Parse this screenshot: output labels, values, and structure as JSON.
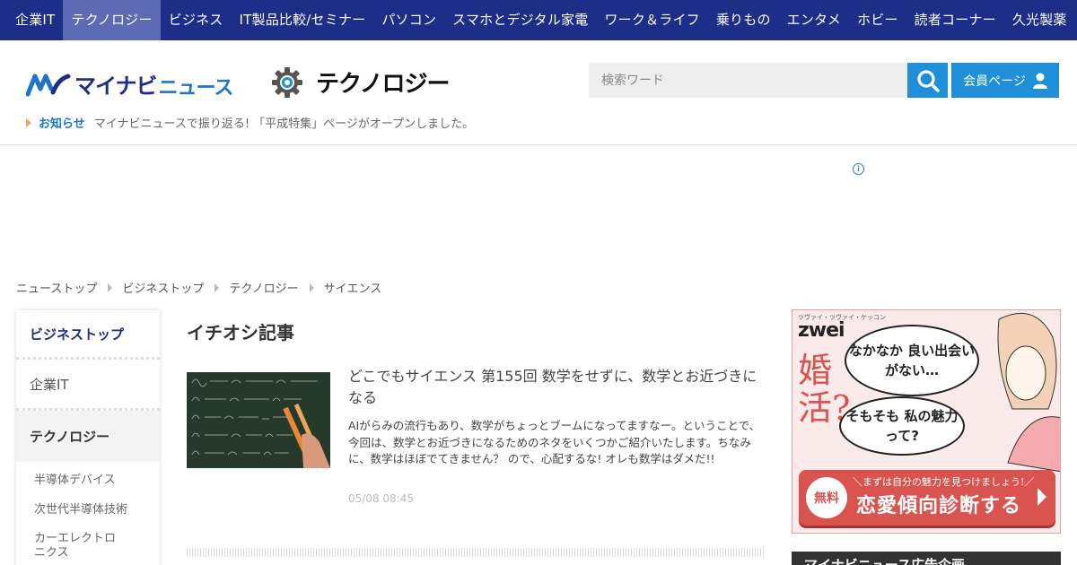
{
  "topnav": {
    "items": [
      "企業IT",
      "テクノロジー",
      "ビジネス",
      "IT製品比較/セミナー",
      "パソコン",
      "スマホとデジタル家電",
      "ワーク＆ライフ",
      "乗りもの",
      "エンタメ",
      "ホビー",
      "読者コーナー",
      "久光製薬"
    ],
    "active_index": 1,
    "bg_color": "#1c2e87",
    "active_color": "#5d6bb5"
  },
  "header": {
    "logo_mynavi": "マイナビ",
    "logo_news": "ニュース",
    "section_name": "テクノロジー",
    "section_icon": "gear-icon",
    "search": {
      "placeholder": "検索ワード",
      "button_icon": "search-icon"
    },
    "member_button": {
      "label": "会員ページ",
      "icon": "user-icon"
    },
    "accent_color": "#1e8fd8"
  },
  "notice": {
    "label": "お知らせ",
    "text": "マイナビニュースで振り返る! 「平成特集」ページがオープンしました。"
  },
  "ad_info_icon": "info-icon",
  "breadcrumb": [
    "ニューストップ",
    "ビジネストップ",
    "テクノロジー",
    "サイエンス"
  ],
  "sidebar": {
    "head": "ビジネストップ",
    "items": [
      "企業IT",
      "テクノロジー"
    ],
    "active_item": "テクノロジー",
    "sub_items": [
      "半導体デバイス",
      "次世代半導体技術",
      "カーエレクトロニクス"
    ]
  },
  "main": {
    "title": "イチオシ記事",
    "article": {
      "title": "どこでもサイエンス 第155回 数学をせずに、数学とお近づきになる",
      "desc": "AIがらみの流行もあり、数学がちょっとブームになってますなー。ということで、今回は、数学とお近づきになるためのネタをいくつかご紹介いたします。ちなみに、数学はほぼでてきません？ ので、心配するな! オレも数学はダメだ!!",
      "date": "05/08 08:45"
    }
  },
  "right_ad": {
    "top_text": "ツヴァイ・ツヴァイ・ケッコン",
    "brand": "zwei",
    "konkatsu": "婚活?",
    "bubble1": "なかなか 良い出会いがない…",
    "bubble2": "そもそも 私の魅力って?",
    "cta_sub": "＼まずは自分の魅力を見つけましょう!／",
    "cta_free": "無料",
    "cta_main": "恋愛傾向診断する"
  },
  "right_box_title": "マイナビニュース広告企画"
}
